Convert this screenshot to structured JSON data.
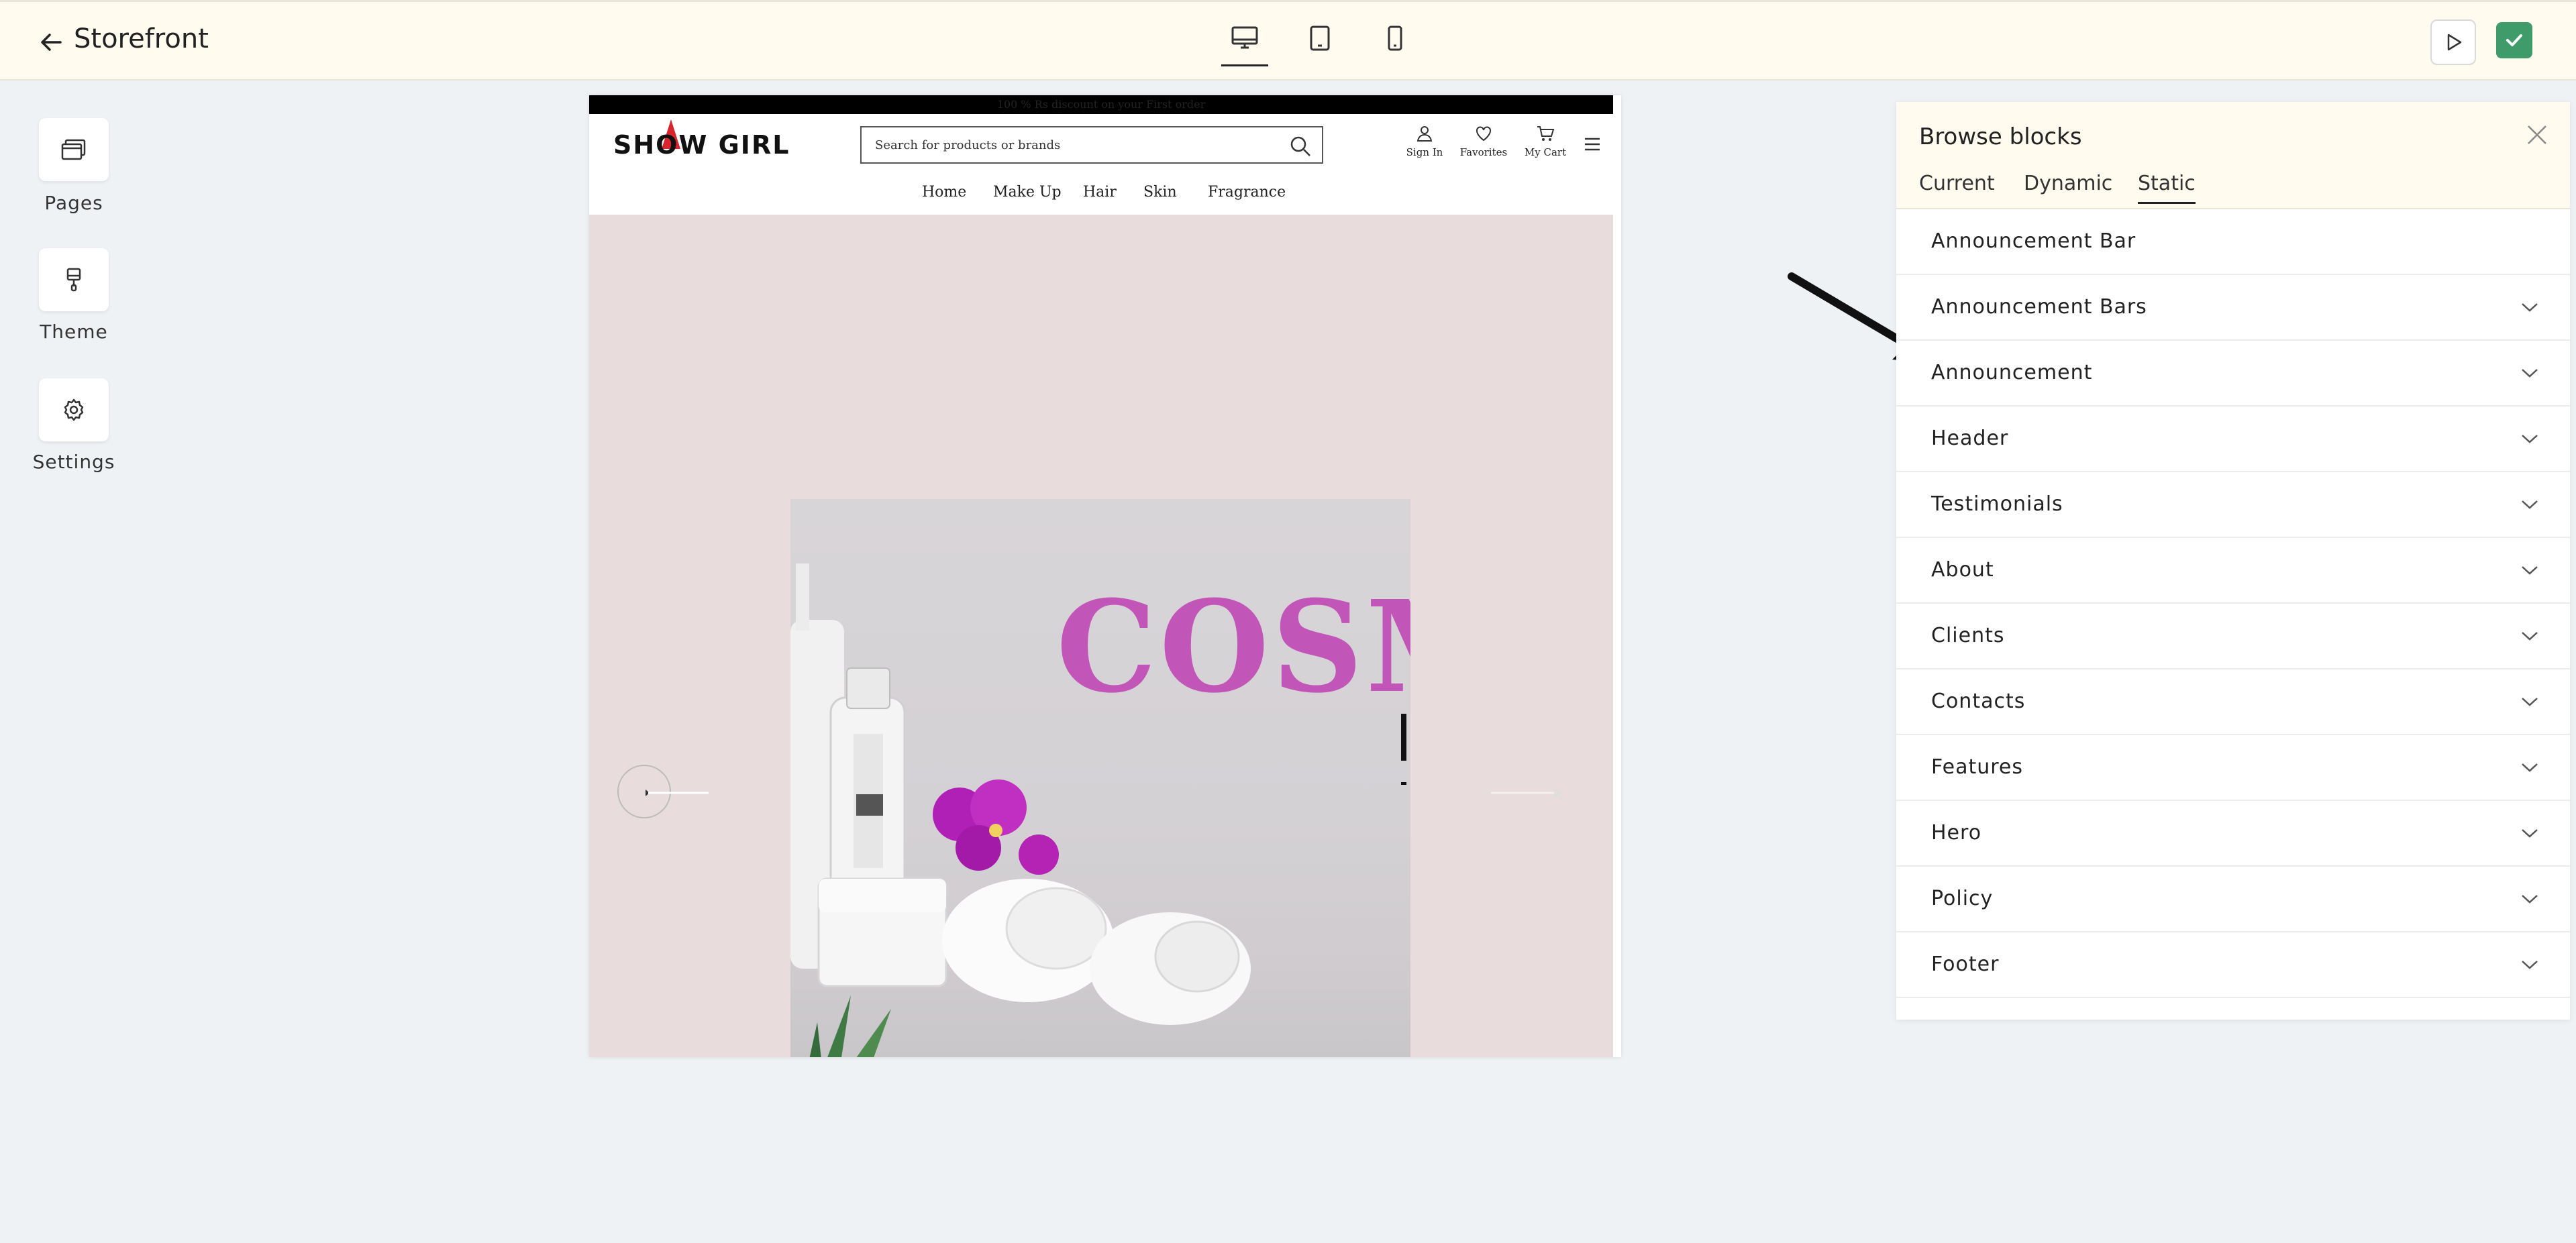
{
  "topbar": {
    "title": "Storefront",
    "devices": [
      "desktop-icon",
      "tablet-icon",
      "mobile-icon"
    ],
    "active_device": "desktop"
  },
  "rail": {
    "items": [
      {
        "label": "Pages",
        "icon": "pages-icon"
      },
      {
        "label": "Theme",
        "icon": "brush-icon"
      },
      {
        "label": "Settings",
        "icon": "gear-icon"
      }
    ]
  },
  "preview": {
    "announcement": "100 % Rs discount on your First order",
    "logo": "SHOW GIRL",
    "search_placeholder": "Search for products or brands",
    "header_icons": [
      {
        "label": "Sign In",
        "icon": "user-icon"
      },
      {
        "label": "Favorites",
        "icon": "heart-icon"
      },
      {
        "label": "My Cart",
        "icon": "cart-icon"
      }
    ],
    "nav": [
      "Home",
      "Make Up",
      "Hair",
      "Skin",
      "Fragrance"
    ],
    "hero_text": "COSM"
  },
  "panel": {
    "title": "Browse blocks",
    "tabs": [
      "Current",
      "Dynamic",
      "Static"
    ],
    "active_tab": "Static",
    "blocks": [
      {
        "label": "Announcement Bar",
        "expandable": false
      },
      {
        "label": "Announcement Bars",
        "expandable": true
      },
      {
        "label": "Announcement",
        "expandable": true
      },
      {
        "label": "Header",
        "expandable": true
      },
      {
        "label": "Testimonials",
        "expandable": true
      },
      {
        "label": "About",
        "expandable": true
      },
      {
        "label": "Clients",
        "expandable": true
      },
      {
        "label": "Contacts",
        "expandable": true
      },
      {
        "label": "Features",
        "expandable": true
      },
      {
        "label": "Hero",
        "expandable": true
      },
      {
        "label": "Policy",
        "expandable": true
      },
      {
        "label": "Footer",
        "expandable": true
      }
    ]
  },
  "colors": {
    "topbar_bg": "#fffbef",
    "confirm_green": "#3f9c6a",
    "hero_bg": "#e8dcdc",
    "hero_text": "#c255b8",
    "whatsapp": "#4caf50"
  }
}
